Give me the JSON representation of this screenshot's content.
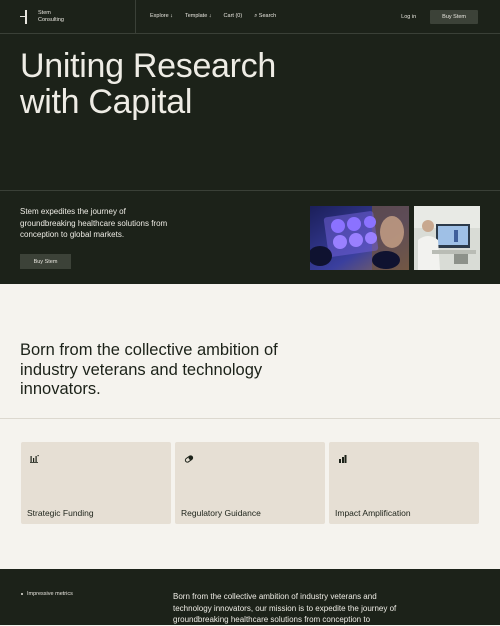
{
  "header": {
    "logo_line1": "Stem",
    "logo_line2": "Consulting",
    "nav": [
      "Explore ↓",
      "Template ↓",
      "Cart (0)",
      "⌕ Search"
    ],
    "login": "Log in",
    "buy": "Buy Stem"
  },
  "hero": {
    "title": "Uniting Research with Capital",
    "subtitle": "Stem expedites the journey of groundbreaking healthcare solutions from conception to global markets.",
    "buy": "Buy Stem"
  },
  "about": {
    "title": "Born from the collective ambition of industry veterans and technology innovators."
  },
  "cards": [
    {
      "label": "Strategic Funding",
      "icon": "funding-icon"
    },
    {
      "label": "Regulatory Guidance",
      "icon": "pill-icon"
    },
    {
      "label": "Impact Amplification",
      "icon": "bar-chart-icon"
    }
  ],
  "bottom": {
    "metrics_label": "Impressive metrics",
    "mission": "Born from the collective ambition of industry veterans and technology innovators, our mission is to expedite the journey of groundbreaking healthcare solutions from conception to"
  },
  "colors": {
    "dark": "#1c2219",
    "cream": "#f5f3ee",
    "card": "#e6dfd4"
  }
}
